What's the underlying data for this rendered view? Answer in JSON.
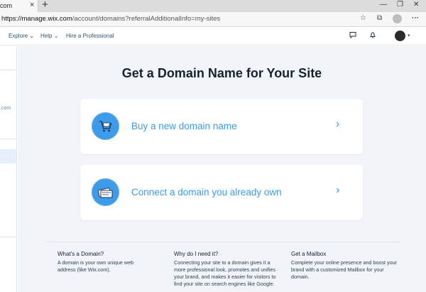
{
  "browser": {
    "tab_title": "com",
    "tab_close": "×",
    "new_tab": "+",
    "url_host": "https://manage.wix.com",
    "url_path": "/account/domains?referralAdditionalInfo=my-sites",
    "window_controls": [
      "—",
      "❐",
      "✕"
    ],
    "toolbar_icons": [
      "star-icon",
      "collections-icon",
      "profile-icon",
      "more-icon"
    ],
    "more_icon_glyph": "···"
  },
  "nav": {
    "items": [
      "Explore",
      "Help",
      "Hire a Professional"
    ],
    "icons": [
      "chat-icon",
      "bell-icon",
      "avatar"
    ]
  },
  "sidebar": {
    "partial_text": ".com"
  },
  "main": {
    "title": "Get a Domain Name for Your Site",
    "cards": [
      {
        "label": "Buy a new domain name",
        "icon": "cart-icon"
      },
      {
        "label": "Connect a domain you already own",
        "icon": "domain-card-icon"
      }
    ],
    "info": [
      {
        "title": "What's a Domain?",
        "text": "A domain is your own unique web address (like Wix.com)."
      },
      {
        "title": "Why do I need it?",
        "text": "Connecting your site to a domain gives it a more professional look, promotes and unifies your brand, and makes it easier for visitors to find your site on search engines like Google."
      },
      {
        "title": "Get a Mailbox",
        "text": "Complete your online presence and boost your brand with a customized Mailbox for your domain."
      }
    ]
  },
  "colors": {
    "accent": "#3d9be9",
    "page_bg": "#f1f5f9",
    "title_text": "#16222e"
  }
}
